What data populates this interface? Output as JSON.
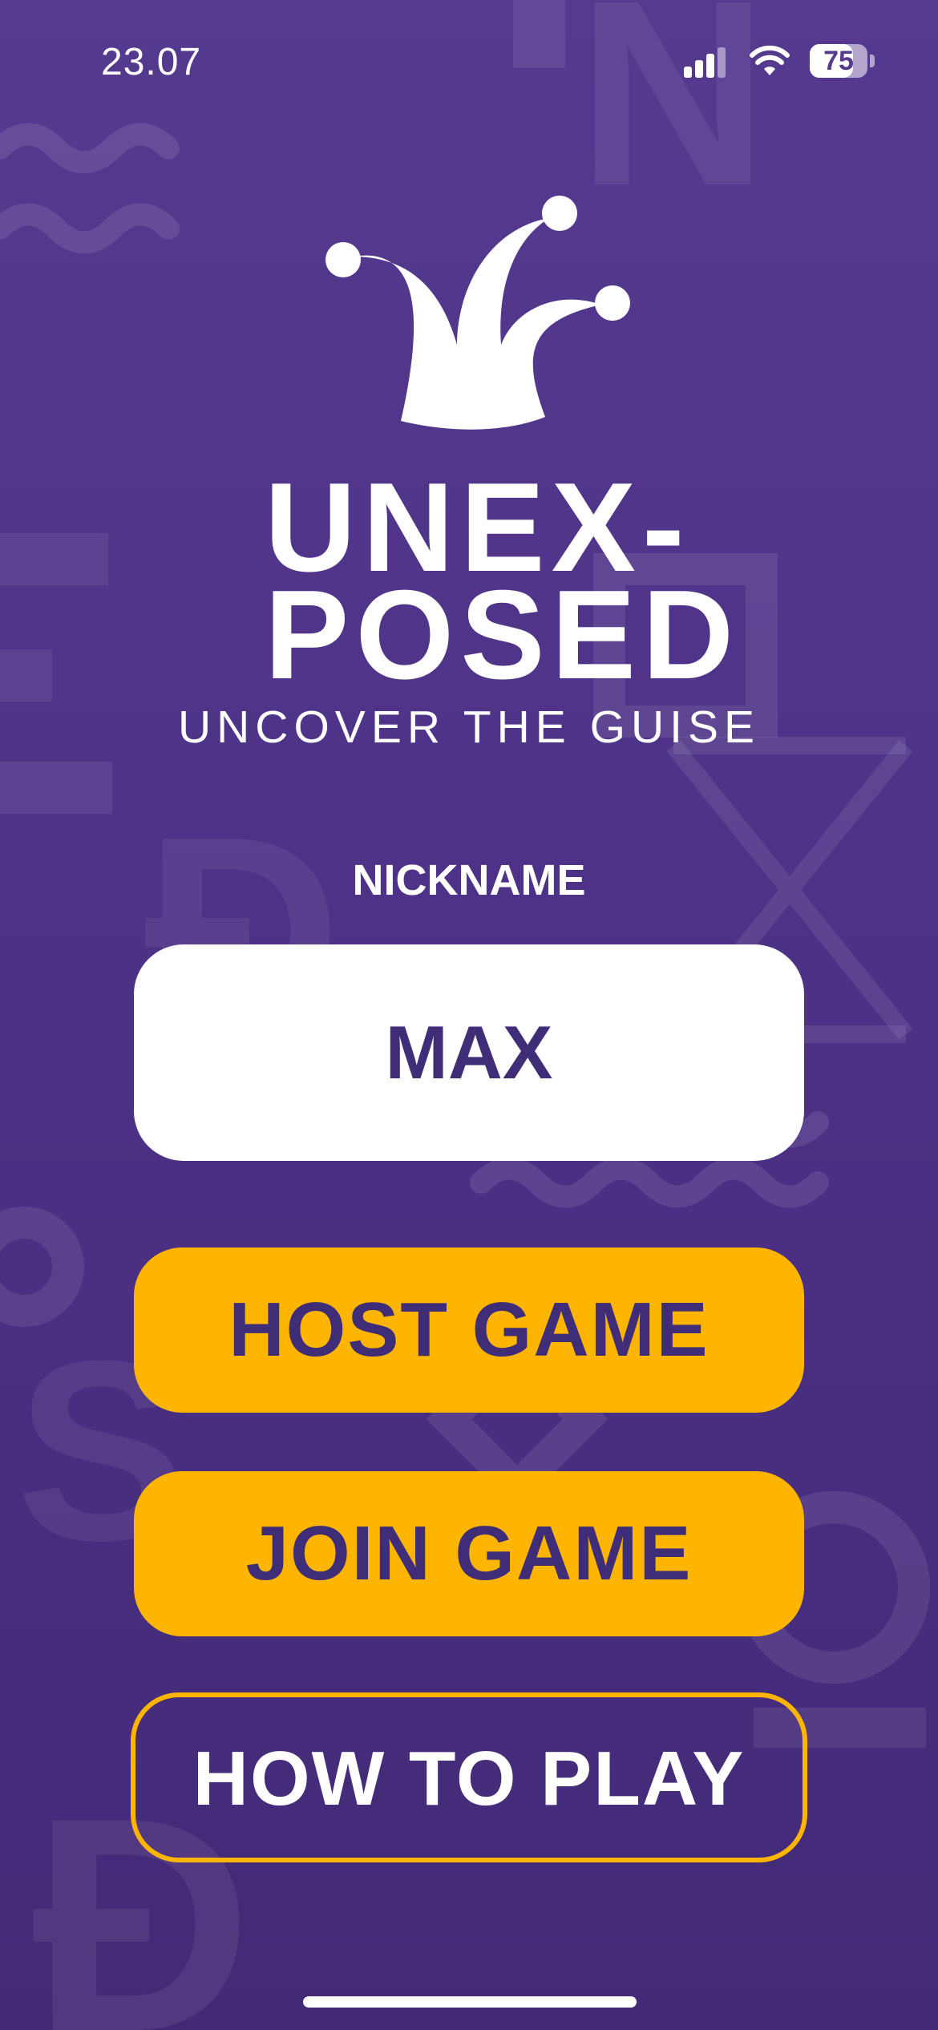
{
  "status_bar": {
    "time": "23.07",
    "battery_level": "75",
    "battery_fraction": 0.75
  },
  "logo": {
    "line1": "UNEX-",
    "line2": "POSED",
    "tagline": "UNCOVER THE GUISE"
  },
  "form": {
    "nickname_label": "NICKNAME",
    "nickname_value": "MAX"
  },
  "buttons": {
    "host": "HOST GAME",
    "join": "JOIN GAME",
    "how_to_play": "HOW TO PLAY"
  },
  "colors": {
    "background": "#553a8f",
    "accent": "#fdb500",
    "text_dark": "#3f2d78",
    "text_light": "#ffffff"
  },
  "icons": {
    "logo": "jester-hat-icon",
    "signal": "cellular-signal-icon",
    "wifi": "wifi-icon",
    "battery": "battery-icon"
  }
}
